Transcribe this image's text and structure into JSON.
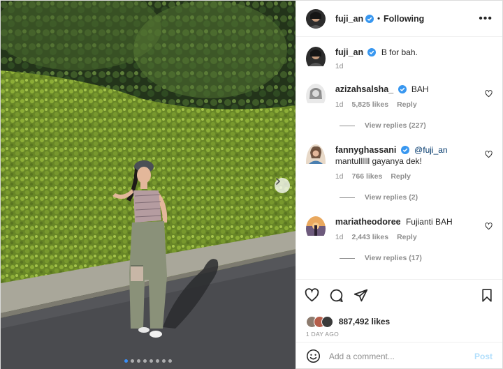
{
  "post": {
    "author": "fuji_an",
    "separator": "•",
    "follow_status": "Following",
    "more_label": "•••",
    "caption": "B for bah.",
    "caption_age": "1d"
  },
  "comments": [
    {
      "username": "azizahsalsha_",
      "text": "BAH",
      "age": "1d",
      "likes": "5,825 likes",
      "reply_label": "Reply",
      "view_replies": "View replies (227)"
    },
    {
      "username": "fannyghassani",
      "mention": "@fuji_an",
      "text": "mantullllll gayanya dek!",
      "age": "1d",
      "likes": "766 likes",
      "reply_label": "Reply",
      "view_replies": "View replies (2)"
    },
    {
      "username": "mariatheodoree",
      "text": "Fujianti BAH",
      "age": "1d",
      "likes": "2,443 likes",
      "reply_label": "Reply",
      "view_replies": "View replies (17)"
    }
  ],
  "engagement": {
    "likes_count": "887,492 likes",
    "timestamp": "1 DAY AGO"
  },
  "composer": {
    "placeholder": "Add a comment...",
    "post_label": "Post"
  },
  "carousel": {
    "total_slides": 8,
    "active_index": 0
  },
  "colors": {
    "verified_blue": "#3897f0",
    "muted_text": "#8e8e8e",
    "post_button_disabled": "#b2dffc"
  },
  "icons": {
    "header_more": "more-horizontal-icon",
    "like": "heart-icon",
    "comment": "comment-icon",
    "share": "send-icon",
    "save": "bookmark-icon",
    "emoji": "smiley-icon",
    "next": "chevron-right-icon"
  }
}
